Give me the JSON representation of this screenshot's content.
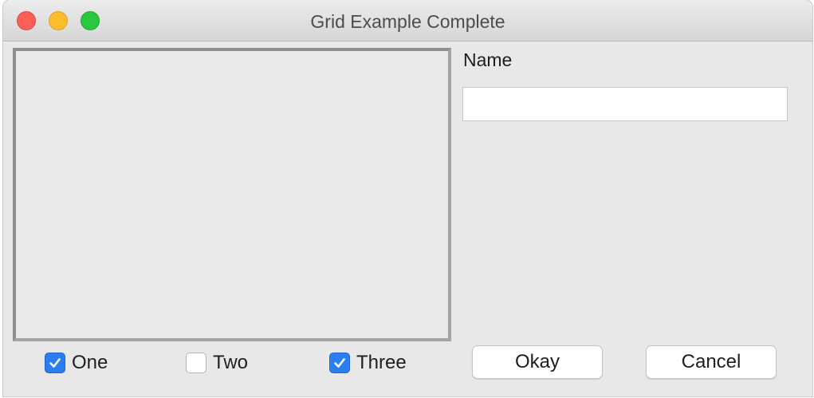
{
  "window": {
    "title": "Grid Example Complete"
  },
  "name_field": {
    "label": "Name",
    "value": "",
    "placeholder": ""
  },
  "checkboxes": [
    {
      "label": "One",
      "checked": true
    },
    {
      "label": "Two",
      "checked": false
    },
    {
      "label": "Three",
      "checked": true
    }
  ],
  "buttons": {
    "okay_label": "Okay",
    "cancel_label": "Cancel"
  },
  "colors": {
    "accent": "#2a7ef0",
    "close": "#fc5f57",
    "minimize": "#fdbc2e",
    "maximize": "#28c840"
  }
}
